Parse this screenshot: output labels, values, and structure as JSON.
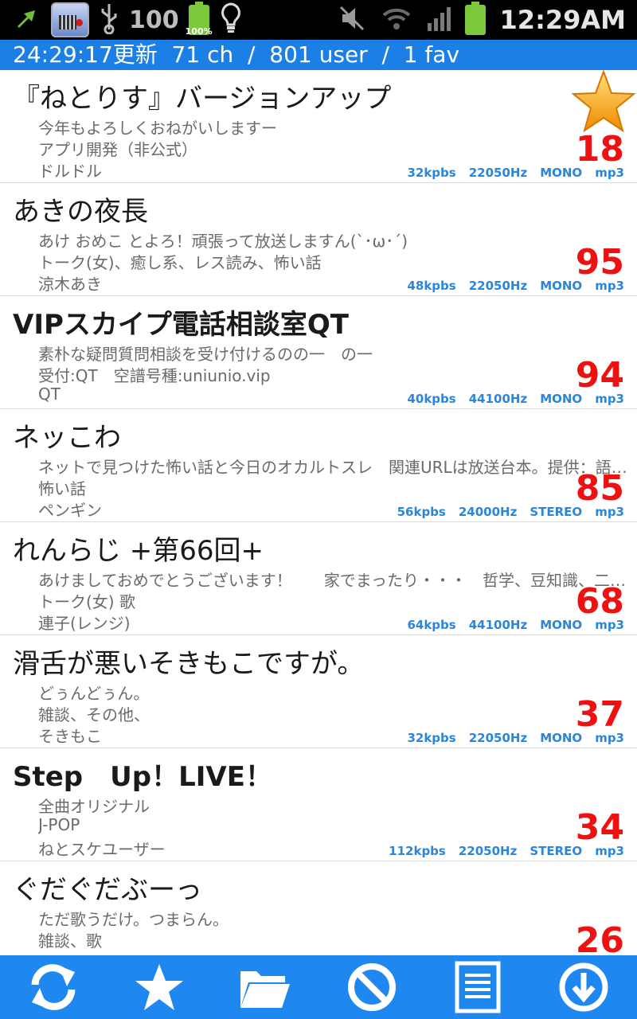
{
  "status_bar": {
    "notification_count": "100",
    "battery_percent": "100%",
    "clock": "12:29AM"
  },
  "info_bar": {
    "text": "24:29:17更新  71 ch  /  801 user  /  1 fav"
  },
  "channels": [
    {
      "title": "『ねとりす』バージョンアップ",
      "bold": false,
      "lines": [
        "今年もよろしくおねがいしますー",
        "アプリ開発（非公式）",
        "ドルドル"
      ],
      "listeners": "18",
      "bitrate": "32kpbs",
      "samplerate": "22050Hz",
      "channels": "MONO",
      "format": "mp3",
      "favorite": true
    },
    {
      "title": "あきの夜長",
      "bold": false,
      "lines": [
        "あけ おめこ とよろ！頑張って放送しますん(`･ω･´)",
        "トーク(女)、癒し系、レス読み、怖い話",
        "涼木あき"
      ],
      "listeners": "95",
      "bitrate": "48kpbs",
      "samplerate": "22050Hz",
      "channels": "MONO",
      "format": "mp3",
      "favorite": false
    },
    {
      "title": "VIPスカイプ電話相談室QT",
      "bold": true,
      "lines": [
        "素朴な疑問質問相談を受け付けるのの一　の一",
        "受付:QT　空譜号種:uniunio.vip",
        "QT"
      ],
      "listeners": "94",
      "bitrate": "40kpbs",
      "samplerate": "44100Hz",
      "channels": "MONO",
      "format": "mp3",
      "favorite": false
    },
    {
      "title": "ネッこわ",
      "bold": false,
      "lines": [
        "ネットで見つけた怖い話と今日のオカルトスレ　関連URLは放送台本。提供：語学…",
        "怖い話",
        "ペンギン"
      ],
      "listeners": "85",
      "bitrate": "56kpbs",
      "samplerate": "24000Hz",
      "channels": "STEREO",
      "format": "mp3",
      "favorite": false
    },
    {
      "title": "れんらじ +第66回+",
      "bold": false,
      "lines": [
        "あけましておめでとうございます！　　家でまったり・・・　哲学、豆知識、二…",
        "トーク(女) 歌",
        "連子(レンジ)"
      ],
      "listeners": "68",
      "bitrate": "64kpbs",
      "samplerate": "44100Hz",
      "channels": "MONO",
      "format": "mp3",
      "favorite": false
    },
    {
      "title": "滑舌が悪いそきもこですが。",
      "bold": false,
      "lines": [
        "どぅんどぅん。",
        "雑談、その他、",
        "そきもこ"
      ],
      "listeners": "37",
      "bitrate": "32kpbs",
      "samplerate": "22050Hz",
      "channels": "MONO",
      "format": "mp3",
      "favorite": false
    },
    {
      "title": "Step　Up！LIVE！",
      "bold": true,
      "lines": [
        "全曲オリジナル",
        "J-POP",
        "ねとスケユーザー"
      ],
      "listeners": "34",
      "bitrate": "112kpbs",
      "samplerate": "22050Hz",
      "channels": "STEREO",
      "format": "mp3",
      "favorite": false
    },
    {
      "title": "ぐだぐだぶーっ",
      "bold": false,
      "lines": [
        "ただ歌うだけ。つまらん。",
        "雑談、歌",
        ""
      ],
      "listeners": "26",
      "bitrate": "",
      "samplerate": "",
      "channels": "",
      "format": "",
      "favorite": false
    }
  ],
  "toolbar": {
    "buttons": [
      {
        "name": "refresh-button",
        "icon": "refresh-icon"
      },
      {
        "name": "favorites-button",
        "icon": "star-icon"
      },
      {
        "name": "folder-button",
        "icon": "folder-icon"
      },
      {
        "name": "block-button",
        "icon": "block-icon"
      },
      {
        "name": "list-button",
        "icon": "document-icon"
      },
      {
        "name": "download-button",
        "icon": "download-icon"
      }
    ]
  },
  "colors": {
    "accent": "#1e88f0",
    "listener_count": "#ee1111",
    "meta": "#2a86dc"
  }
}
